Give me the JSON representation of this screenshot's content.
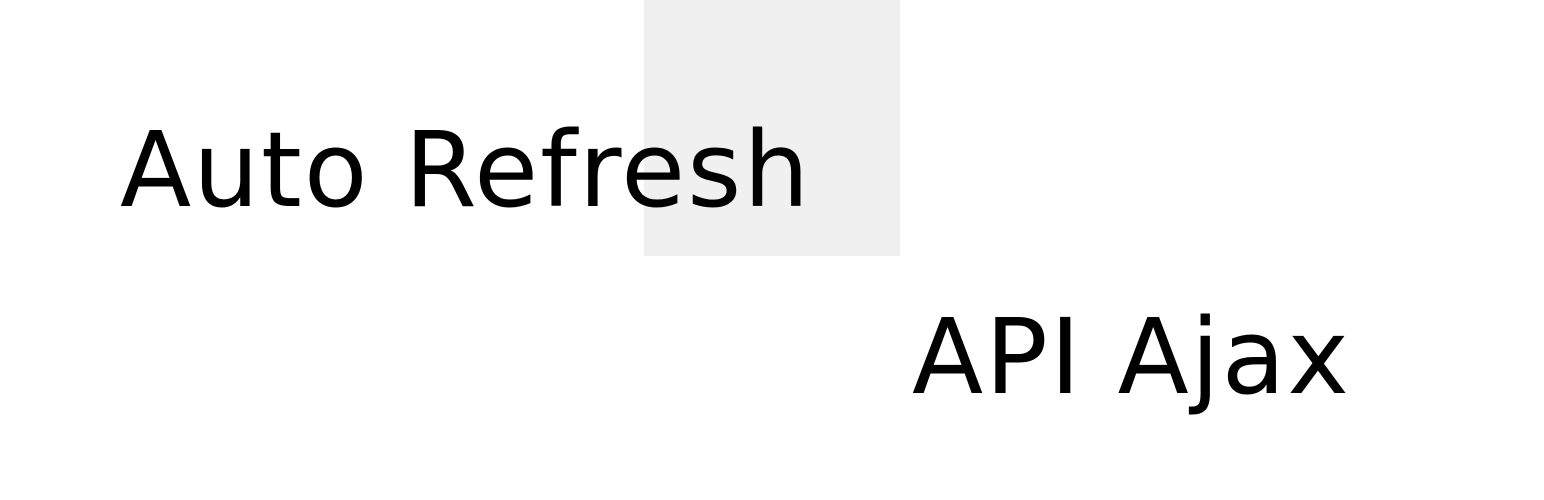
{
  "labels": {
    "primary": "Auto Refresh",
    "secondary": "API Ajax"
  },
  "colors": {
    "background": "#ffffff",
    "highlight": "#f0f0f0",
    "text": "#000000"
  }
}
